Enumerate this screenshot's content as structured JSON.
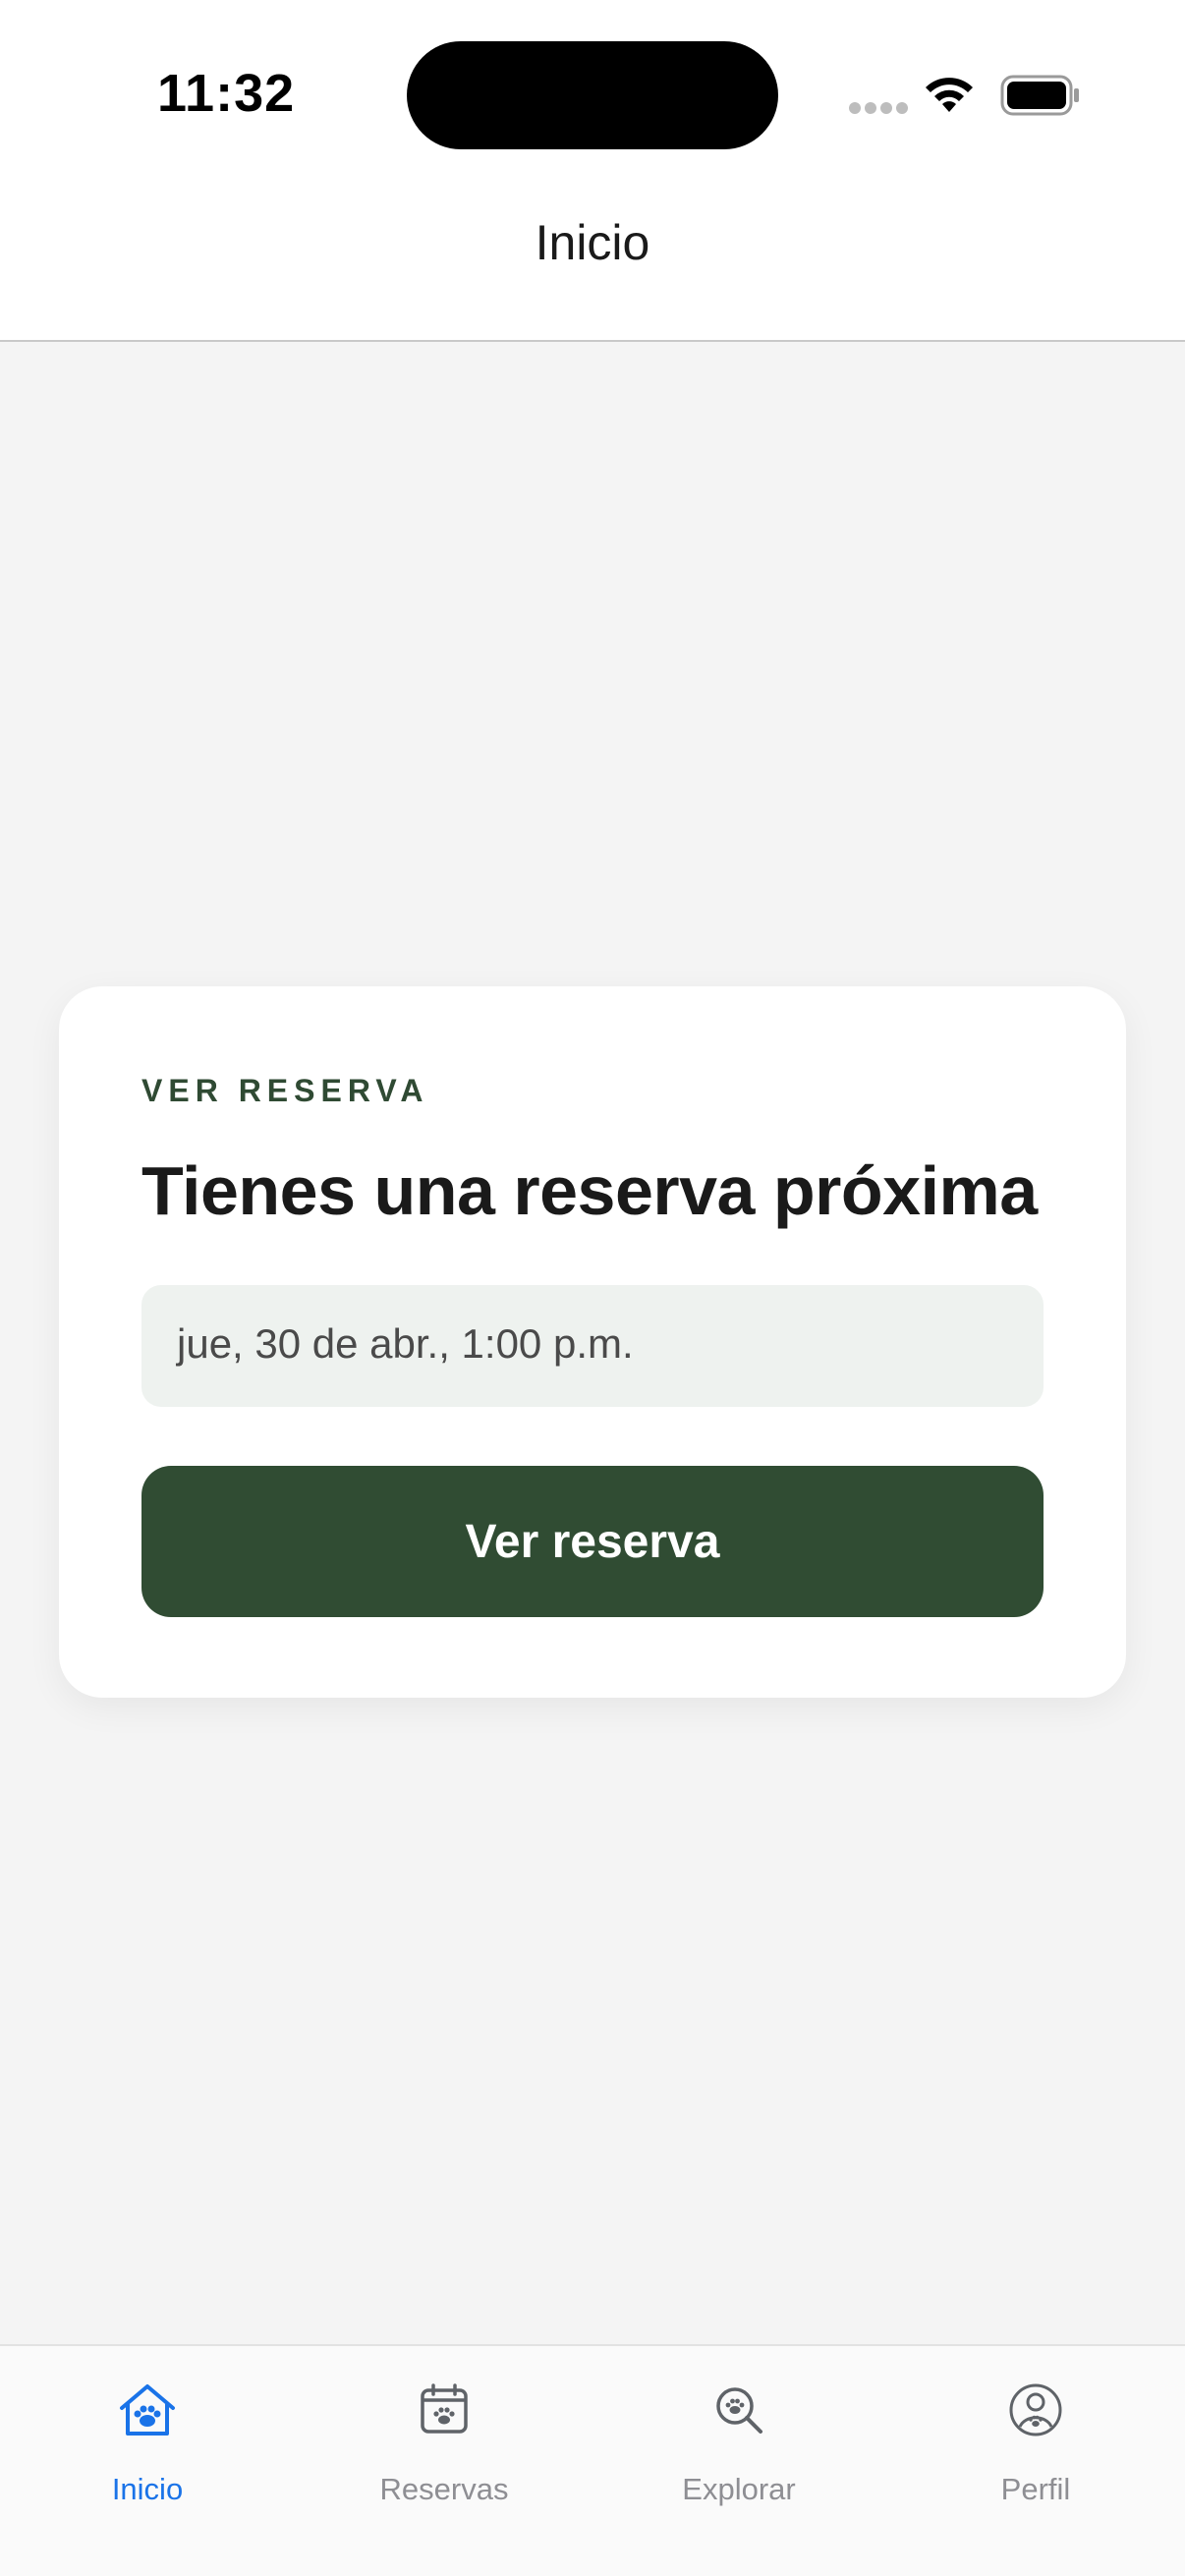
{
  "status_bar": {
    "time": "11:32",
    "icons": [
      "signal-icon",
      "wifi-icon",
      "battery-icon"
    ]
  },
  "header": {
    "title": "Inicio"
  },
  "reservation_card": {
    "eyebrow": "VER RESERVA",
    "headline": "Tienes una reserva próxima",
    "datetime": "jue, 30 de abr., 1:00 p.m.",
    "button_label": "Ver reserva"
  },
  "tab_bar": {
    "active_color": "#1a73e8",
    "inactive_color": "#8e8e93",
    "tabs": [
      {
        "label": "Inicio",
        "icon": "home-paw-icon",
        "active": true
      },
      {
        "label": "Reservas",
        "icon": "calendar-paw-icon",
        "active": false
      },
      {
        "label": "Explorar",
        "icon": "search-paw-icon",
        "active": false
      },
      {
        "label": "Perfil",
        "icon": "profile-paw-icon",
        "active": false
      }
    ]
  },
  "colors": {
    "brand_green": "#304c33",
    "background": "#f4f4f4",
    "card": "#ffffff"
  }
}
